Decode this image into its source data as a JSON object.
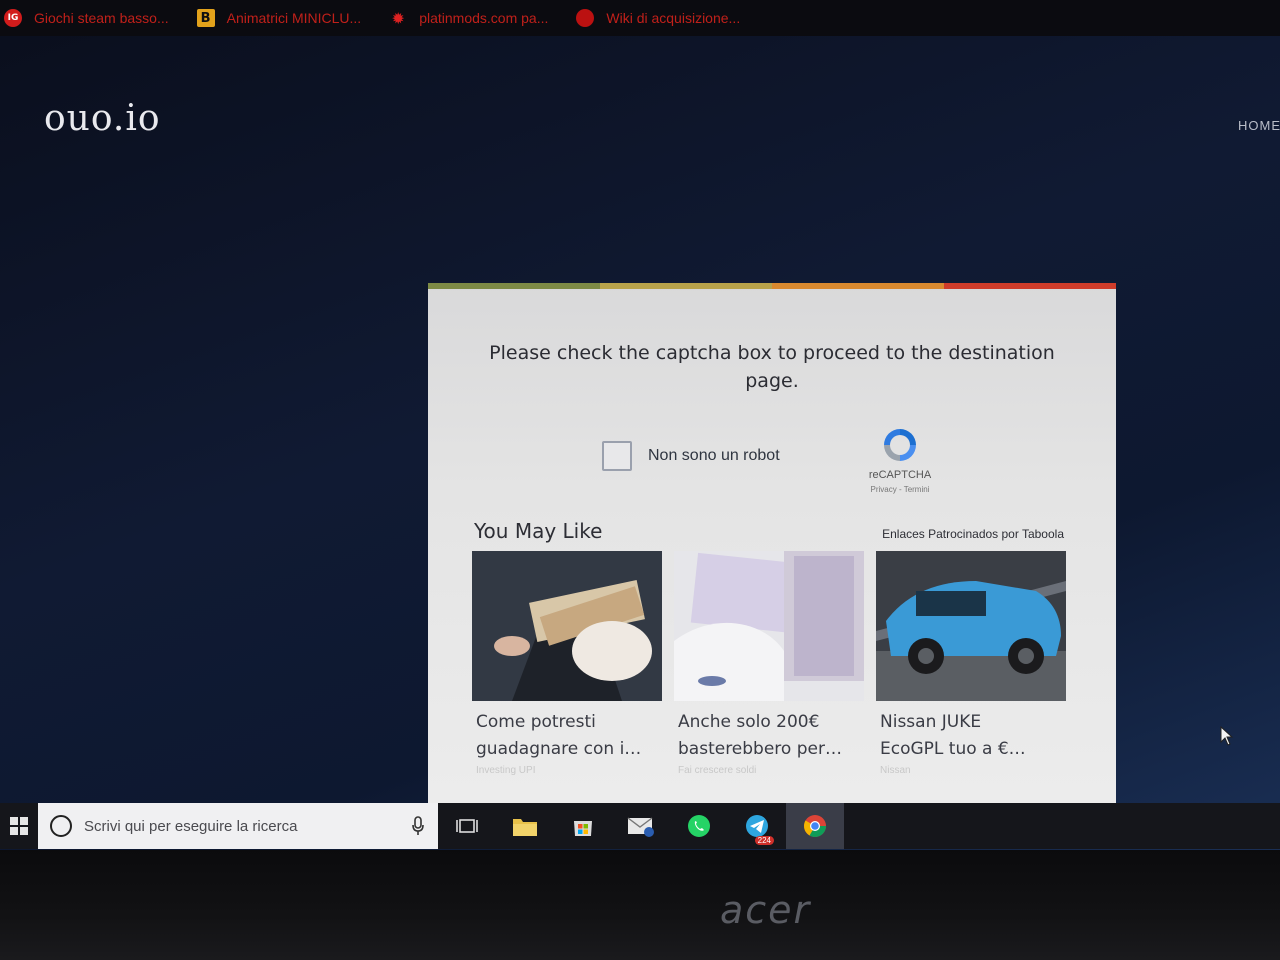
{
  "bookmarks": [
    {
      "icon": "IG",
      "label": "Giochi steam basso..."
    },
    {
      "icon": "B",
      "label": "Animatrici MINICLU..."
    },
    {
      "icon": "✹",
      "label": "platinmods.com pa..."
    },
    {
      "icon": "",
      "label": "Wiki di acquisizione..."
    }
  ],
  "site": {
    "logo": "ouo.io",
    "nav_home": "HOME"
  },
  "modal": {
    "title": "Please check the captcha box to proceed to the destination page.",
    "captcha": {
      "label": "Non sono un robot",
      "brand": "reCAPTCHA",
      "links": "Privacy - Termini"
    },
    "recommend_title": "You May Like",
    "sponsor": "Enlaces Patrocinados por Taboola",
    "stripe_colors": [
      "#7d8a45",
      "#b8a24a",
      "#d9892f",
      "#cf3c2a"
    ],
    "cards": [
      {
        "title": "Come potresti\nguadagnare con i…",
        "source": "Investing UPI"
      },
      {
        "title": "Anche solo 200€\nbasterebbero per…",
        "source": "Fai crescere soldi"
      },
      {
        "title": "Nissan JUKE\nEcoGPL tuo a €…",
        "source": "Nissan"
      }
    ]
  },
  "taskbar": {
    "search_placeholder": "Scrivi qui per eseguire la ricerca",
    "telegram_badge": "224",
    "icons": [
      "windows-icon",
      "task-view-icon",
      "file-explorer-icon",
      "store-icon",
      "mail-icon",
      "whatsapp-icon",
      "telegram-icon",
      "chrome-icon"
    ]
  },
  "laptop": {
    "brand": "acer"
  }
}
